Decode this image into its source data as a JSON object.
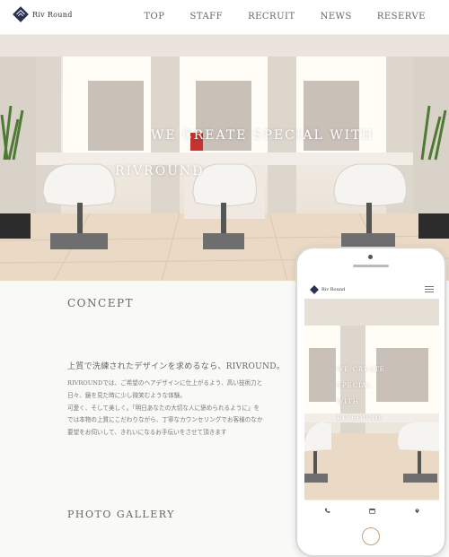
{
  "site": {
    "logo_text": "Riv Round"
  },
  "nav": {
    "items": [
      "TOP",
      "STAFF",
      "RECRUIT",
      "NEWS",
      "RESERVE"
    ]
  },
  "hero": {
    "line1": "WE CREATE SPECIAL WITH",
    "line2": "RIVROUND"
  },
  "concept": {
    "title": "CONCEPT",
    "lead": "上質で洗練されたデザインを求めるなら、RIVROUND。",
    "body": [
      "RIVROUNDでは、ご希望のヘアデザインに仕上がるよう、高い技術力と",
      "日々、鏡を見た時に少し微笑むような体験。",
      "可愛く、そして美しく。「明日あなたの大切な人に褒められるように」を",
      "では本物の上質にこだわりながら、丁寧なカウンセリングでお客様のなか",
      "要望をお伺いして、きれいになるお手伝いをさせて頂きます"
    ]
  },
  "gallery": {
    "title": "PHOTO GALLERY"
  },
  "mobile": {
    "logo_text": "Riv Round",
    "hero_lines": "WE CREATE\nSPECIAL\nWITH\nRIVROUND",
    "footer_icons": [
      "phone-icon",
      "calendar-icon",
      "map-pin-icon"
    ]
  },
  "colors": {
    "accent_gold": "#c9a27a",
    "logo_navy": "#2b3050"
  }
}
